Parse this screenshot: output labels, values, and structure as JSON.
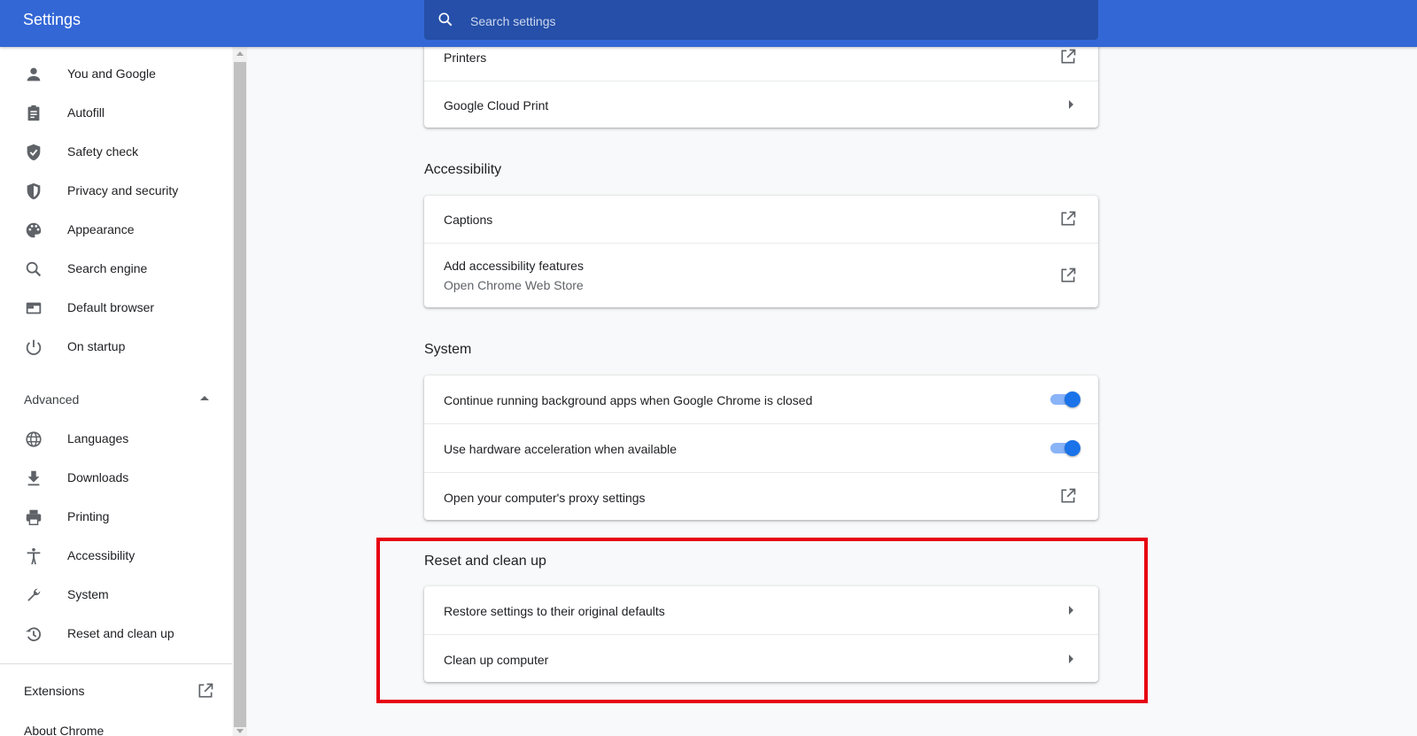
{
  "app": {
    "title": "Settings"
  },
  "search": {
    "placeholder": "Search settings"
  },
  "sidebar": {
    "items": [
      {
        "label": "You and Google",
        "icon": "person-icon"
      },
      {
        "label": "Autofill",
        "icon": "clipboard-icon"
      },
      {
        "label": "Safety check",
        "icon": "shield-check-icon"
      },
      {
        "label": "Privacy and security",
        "icon": "shield-half-icon"
      },
      {
        "label": "Appearance",
        "icon": "palette-icon"
      },
      {
        "label": "Search engine",
        "icon": "search-icon"
      },
      {
        "label": "Default browser",
        "icon": "browser-window-icon"
      },
      {
        "label": "On startup",
        "icon": "power-icon"
      }
    ],
    "advanced_label": "Advanced",
    "advanced_items": [
      {
        "label": "Languages",
        "icon": "globe-icon"
      },
      {
        "label": "Downloads",
        "icon": "download-icon"
      },
      {
        "label": "Printing",
        "icon": "printer-icon"
      },
      {
        "label": "Accessibility",
        "icon": "accessibility-icon"
      },
      {
        "label": "System",
        "icon": "wrench-icon"
      },
      {
        "label": "Reset and clean up",
        "icon": "history-icon"
      }
    ],
    "extensions_label": "Extensions",
    "about_label": "About Chrome"
  },
  "main": {
    "printing_card": {
      "printers": "Printers",
      "cloud_print": "Google Cloud Print"
    },
    "accessibility": {
      "title": "Accessibility",
      "captions": "Captions",
      "add_features": "Add accessibility features",
      "add_features_sub": "Open Chrome Web Store"
    },
    "system": {
      "title": "System",
      "background_apps": "Continue running background apps when Google Chrome is closed",
      "background_apps_on": true,
      "hw_accel": "Use hardware acceleration when available",
      "hw_accel_on": true,
      "proxy": "Open your computer's proxy settings"
    },
    "reset": {
      "title": "Reset and clean up",
      "restore": "Restore settings to their original defaults",
      "cleanup": "Clean up computer"
    }
  },
  "colors": {
    "header": "#3367d6",
    "search_bg": "#254fa8",
    "toggle_on": "#1a73e8",
    "highlight": "#e60012"
  }
}
